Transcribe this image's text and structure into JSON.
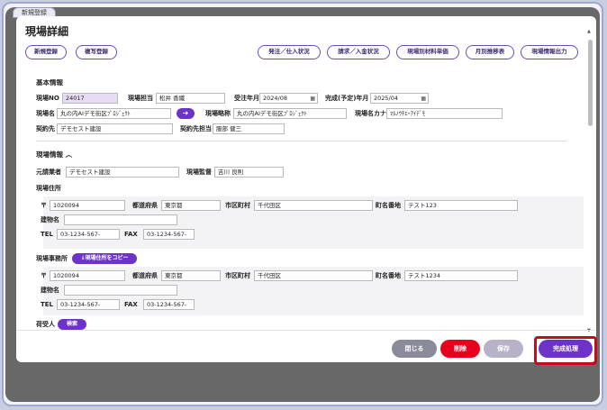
{
  "background_tab": {
    "label": "新規登録"
  },
  "modal": {
    "title": "現場詳細",
    "left_buttons": [
      "新規登録",
      "複写登録"
    ],
    "right_buttons": [
      "発注／仕入状況",
      "請求／入金状況",
      "現場別材料単価",
      "月別推移表",
      "現場情報出力"
    ]
  },
  "basic_info": {
    "section_title": "基本情報",
    "genba_no": {
      "label": "現場NO",
      "value": "24017"
    },
    "genba_tanto": {
      "label": "現場担当",
      "value": "松井 香織"
    },
    "juchu_nengetsu": {
      "label": "受注年月",
      "value": "2024/08"
    },
    "kansei_nengetsu": {
      "label": "完成(予定)年月",
      "value": "2025/04"
    },
    "genba_name": {
      "label": "現場名",
      "value": "丸の内AIデモ街区ﾌﾟﾛｼﾞｪｸﾄ"
    },
    "genba_ryakusho": {
      "label": "現場略称",
      "value": "丸の内AIデモ街区ﾌﾟﾛｼﾞｪｸﾄ"
    },
    "genba_kana": {
      "label": "現場名カナ",
      "value": "ﾏﾙﾉｳﾁｴｰｱｲﾃﾞﾓ"
    },
    "keiyakusaki": {
      "label": "契約先",
      "value": "デモセスト建設"
    },
    "keiyaku_tanto": {
      "label": "契約先担当",
      "value": "服部 健三"
    }
  },
  "site_info": {
    "section_title": "現場情報",
    "toggle_icon": "chevron-up-icon",
    "motouke": {
      "label": "元請業者",
      "value": "デモセスト建設"
    },
    "kantoku": {
      "label": "現場監督",
      "value": "吉川 良則"
    },
    "address_label": "現場住所",
    "address": {
      "postal_mark": "〒",
      "postal": "1020094",
      "pref_label": "都道府県",
      "pref": "東京都",
      "city_label": "市区町村",
      "city": "千代田区",
      "street_label": "町名番地",
      "street": "テスト123",
      "building_label": "建物名",
      "building": "",
      "tel_label": "TEL",
      "tel": "03-1234-567-",
      "fax_label": "FAX",
      "fax": "03-1234-567-"
    },
    "office_label": "現場事務所",
    "copy_button": "↓現場住所をコピー",
    "office": {
      "postal_mark": "〒",
      "postal": "1020094",
      "pref_label": "都道府県",
      "pref": "東京都",
      "city_label": "市区町村",
      "city": "千代田区",
      "street_label": "町名番地",
      "street": "テスト1234",
      "building_label": "建物名",
      "building": "",
      "tel_label": "TEL",
      "tel": "03-1234-567-",
      "fax_label": "FAX",
      "fax": "03-1234-567-"
    },
    "consignee_label": "荷受人",
    "search_button": "検索"
  },
  "footer": {
    "close": "閉じる",
    "delete": "削除",
    "save": "保存",
    "complete": "完成処理"
  },
  "colors": {
    "accent": "#6d33c9",
    "close_btn": "#8a8a9a",
    "delete_btn": "#e6001e",
    "save_btn": "#b8b2c8",
    "highlight": "#c40d1c"
  }
}
